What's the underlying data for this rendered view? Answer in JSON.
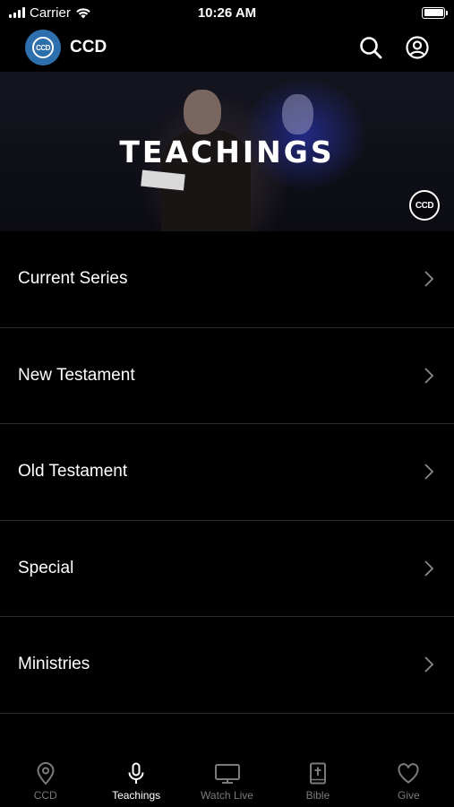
{
  "status_bar": {
    "carrier": "Carrier",
    "time": "10:26 AM"
  },
  "header": {
    "title": "CCD",
    "logo_text": "CCD"
  },
  "hero": {
    "title": "TEACHINGS",
    "badge_text": "CCD"
  },
  "menu": {
    "items": [
      {
        "label": "Current Series"
      },
      {
        "label": "New Testament"
      },
      {
        "label": "Old Testament"
      },
      {
        "label": "Special"
      },
      {
        "label": "Ministries"
      }
    ]
  },
  "tab_bar": {
    "tabs": [
      {
        "label": "CCD",
        "icon": "location-pin-icon",
        "active": false
      },
      {
        "label": "Teachings",
        "icon": "microphone-icon",
        "active": true
      },
      {
        "label": "Watch Live",
        "icon": "tv-icon",
        "active": false
      },
      {
        "label": "Bible",
        "icon": "bible-icon",
        "active": false
      },
      {
        "label": "Give",
        "icon": "heart-icon",
        "active": false
      }
    ]
  },
  "colors": {
    "background": "#000000",
    "accent": "#2e6fae",
    "inactive_tab": "#7a7a7a",
    "divider": "#2a2a2a"
  }
}
